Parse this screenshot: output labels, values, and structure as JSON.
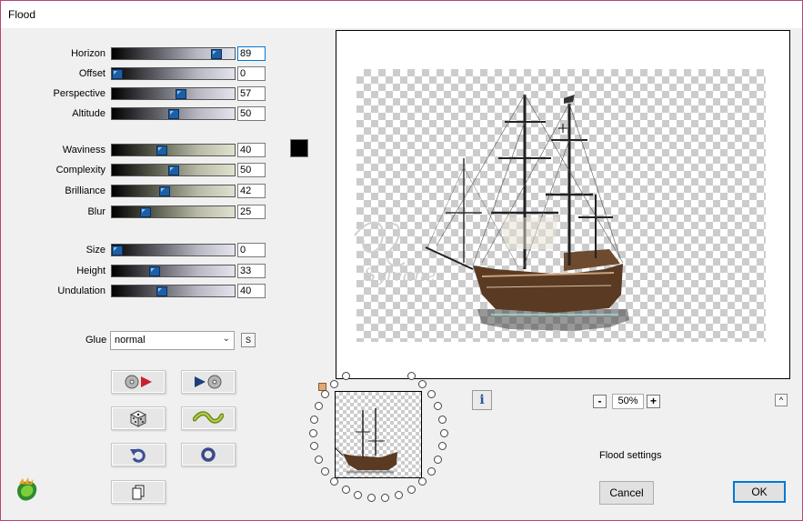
{
  "window": {
    "title": "Flood"
  },
  "sliders": [
    {
      "key": "horizon",
      "label": "Horizon",
      "value": "89",
      "fraction": 0.89,
      "style": "steel"
    },
    {
      "key": "offset",
      "label": "Offset",
      "value": "0",
      "fraction": 0.0,
      "style": "steel"
    },
    {
      "key": "perspective",
      "label": "Perspective",
      "value": "57",
      "fraction": 0.57,
      "style": "steel"
    },
    {
      "key": "altitude",
      "label": "Altitude",
      "value": "50",
      "fraction": 0.5,
      "style": "steel"
    },
    {
      "key": "waviness",
      "label": "Waviness",
      "value": "40",
      "fraction": 0.4,
      "style": "olive"
    },
    {
      "key": "complexity",
      "label": "Complexity",
      "value": "50",
      "fraction": 0.5,
      "style": "olive"
    },
    {
      "key": "brilliance",
      "label": "Brilliance",
      "value": "42",
      "fraction": 0.42,
      "style": "olive"
    },
    {
      "key": "blur",
      "label": "Blur",
      "value": "25",
      "fraction": 0.25,
      "style": "olive"
    },
    {
      "key": "size",
      "label": "Size",
      "value": "0",
      "fraction": 0.0,
      "style": "steel"
    },
    {
      "key": "height",
      "label": "Height",
      "value": "33",
      "fraction": 0.33,
      "style": "steel"
    },
    {
      "key": "undulation",
      "label": "Undulation",
      "value": "40",
      "fraction": 0.4,
      "style": "steel"
    }
  ],
  "glue": {
    "label": "Glue",
    "value": "normal",
    "s_label": "S"
  },
  "colors": {
    "flood_color": "#000000",
    "accent": "#0078d7"
  },
  "tool_buttons": [
    {
      "name": "load-preset-button",
      "icon": "disc-arrow-right-icon"
    },
    {
      "name": "save-preset-button",
      "icon": "play-disc-icon"
    },
    {
      "name": "randomize-button",
      "icon": "dice-icon"
    },
    {
      "name": "wave-button",
      "icon": "wave-icon"
    },
    {
      "name": "undo-button",
      "icon": "undo-arrow-icon"
    },
    {
      "name": "reset-button",
      "icon": "ring-icon"
    },
    {
      "name": "copy-button",
      "icon": "copy-icon"
    }
  ],
  "preview": {
    "watermark": "Sylvane"
  },
  "zoom": {
    "value": "50%",
    "minus": "-",
    "plus": "+"
  },
  "info": {
    "label": "i"
  },
  "up": {
    "label": "^"
  },
  "settings_label": "Flood settings",
  "buttons": {
    "cancel": "Cancel",
    "ok": "OK"
  }
}
